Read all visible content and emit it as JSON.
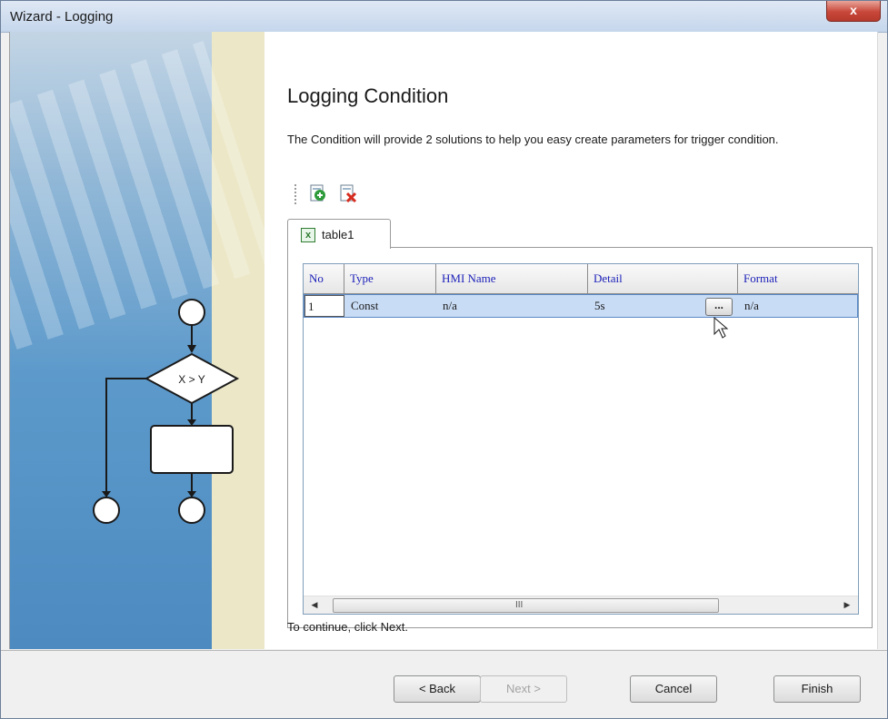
{
  "window": {
    "title": "Wizard - Logging",
    "close_glyph": "x"
  },
  "banner": {
    "decision_label": "X > Y"
  },
  "page": {
    "title": "Logging Condition",
    "description": "The Condition will provide 2 solutions to  help you easy create parameters for trigger condition.",
    "continue_hint": "To continue, click Next."
  },
  "toolbar": {
    "items": [
      {
        "icon": "add-row-icon"
      },
      {
        "icon": "delete-row-icon"
      }
    ]
  },
  "tabs": [
    {
      "label": "table1",
      "icon": "excel-table-icon",
      "icon_glyph": "x"
    }
  ],
  "table": {
    "columns": [
      "No",
      "Type",
      "HMI Name",
      "Detail",
      "Format"
    ],
    "rows": [
      {
        "no": "1",
        "type": "Const",
        "hmi_name": "n/a",
        "detail": "5s",
        "detail_button": "...",
        "format": "n/a"
      }
    ],
    "scroll_grip": "III",
    "scroll_left_glyph": "◀",
    "scroll_right_glyph": "▶"
  },
  "buttons": {
    "back": "< Back",
    "next": "Next >",
    "cancel": "Cancel",
    "finish": "Finish"
  },
  "colors": {
    "header_text": "#1b1fb8",
    "selected_row": "#c9dcf5",
    "banner_bg": "#ebe7c7",
    "close_red": "#c8473a"
  }
}
